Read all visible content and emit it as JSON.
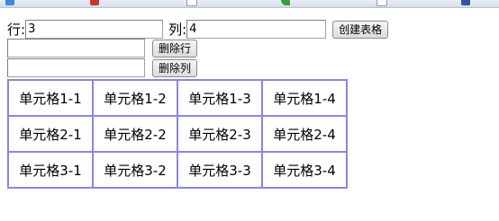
{
  "bookmarks": [
    {
      "icon": "favicon-icon",
      "color": "#3c8ad8"
    },
    {
      "icon": "favicon-icon",
      "color": "#cc3333"
    },
    {
      "icon": "page-icon",
      "color": "#999999"
    },
    {
      "icon": "leaf-icon",
      "color": "#3c9a3c"
    },
    {
      "icon": "page-icon",
      "color": "#999999"
    },
    {
      "icon": "favicon-icon",
      "color": "#3355aa"
    }
  ],
  "form": {
    "rows_label": "行:",
    "rows_value": "3",
    "cols_label": "列:",
    "cols_value": "4",
    "create_button": "创建表格",
    "delete_row_value": "",
    "delete_row_button": "删除行",
    "delete_col_value": "",
    "delete_col_button": "删除列"
  },
  "table": {
    "rows": [
      [
        "单元格1-1",
        "单元格1-2",
        "单元格1-3",
        "单元格1-4"
      ],
      [
        "单元格2-1",
        "单元格2-2",
        "单元格2-3",
        "单元格2-4"
      ],
      [
        "单元格3-1",
        "单元格3-2",
        "单元格3-3",
        "单元格3-4"
      ]
    ],
    "border_color": "#8888dd"
  }
}
